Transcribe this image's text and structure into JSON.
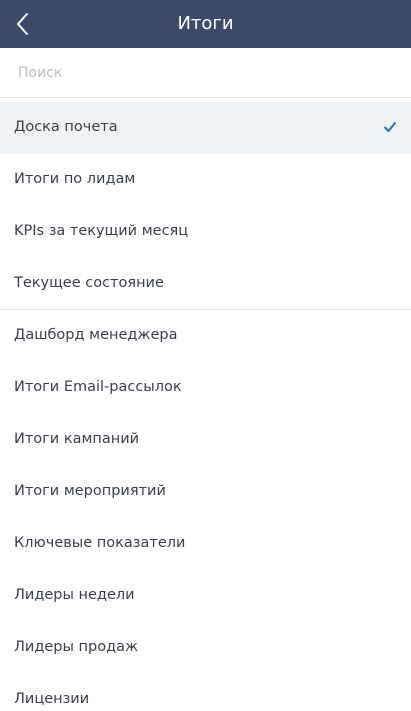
{
  "header": {
    "title": "Итоги",
    "back_icon": "chevron-left-icon"
  },
  "search": {
    "placeholder": "Поиск",
    "value": ""
  },
  "colors": {
    "header_bg": "#3d4b6b",
    "selected_bg": "#f0f3f5",
    "check": "#2f6fb5",
    "text": "#3a3f4a"
  },
  "list": {
    "items": [
      {
        "label": "Доска почета",
        "selected": true,
        "icon": "checkmark-icon"
      },
      {
        "label": "Итоги по лидам"
      },
      {
        "label": "KPIs за текущий месяц"
      },
      {
        "label": "Текущее состояние"
      },
      {
        "label": "Дашборд менеджера"
      },
      {
        "label": "Итоги Email-рассылок"
      },
      {
        "label": "Итоги кампаний"
      },
      {
        "label": "Итоги мероприятий"
      },
      {
        "label": "Ключевые показатели"
      },
      {
        "label": "Лидеры недели"
      },
      {
        "label": "Лидеры продаж"
      },
      {
        "label": "Лицензии"
      }
    ]
  }
}
